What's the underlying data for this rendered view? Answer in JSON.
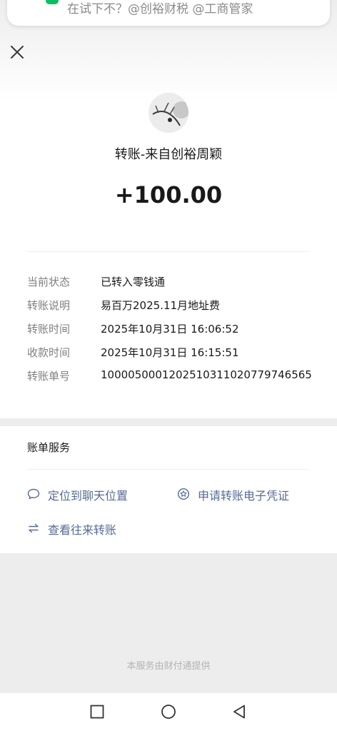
{
  "notification": {
    "text": "在试下不？@创裕财税 @工商管家",
    "icon": "wechat-icon",
    "accent": "#07c160"
  },
  "header": {
    "close_icon": "close-icon"
  },
  "transfer": {
    "title": "转账-来自创裕周颖",
    "amount": "+100.00",
    "details": [
      {
        "label": "当前状态",
        "value": "已转入零钱通"
      },
      {
        "label": "转账说明",
        "value": "易百万2025.11月地址费"
      },
      {
        "label": "转账时间",
        "value": "2025年10月31日 16:06:52"
      },
      {
        "label": "收款时间",
        "value": "2025年10月31日 16:15:51"
      },
      {
        "label": "转账单号",
        "value": "1000050001202510311020779746565"
      }
    ]
  },
  "services": {
    "title": "账单服务",
    "link_color": "#576b95",
    "items": [
      {
        "label": "定位到聊天位置",
        "icon": "chat-bubble-icon"
      },
      {
        "label": "申请转账电子凭证",
        "icon": "certificate-icon"
      },
      {
        "label": "查看往来转账",
        "icon": "transfer-arrows-icon"
      }
    ]
  },
  "footer": {
    "text": "本服务由财付通提供"
  },
  "navbar": {
    "items": [
      "recents-icon",
      "home-icon",
      "back-icon"
    ]
  }
}
